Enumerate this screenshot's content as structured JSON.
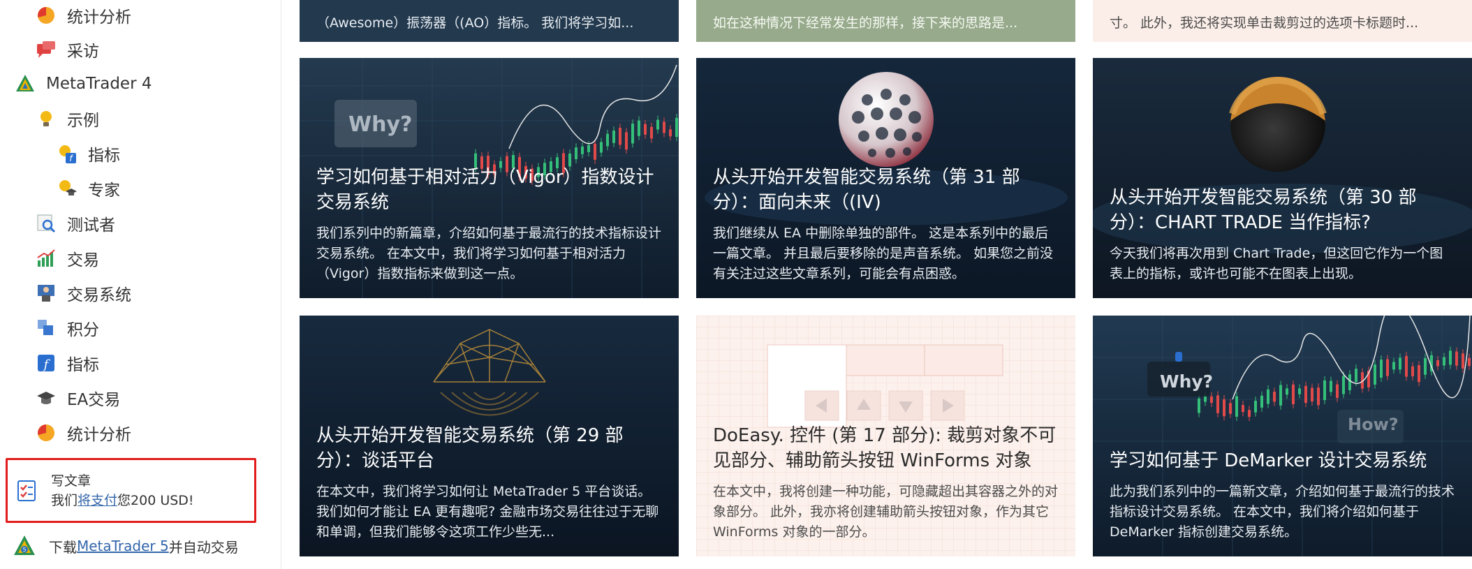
{
  "sidebar": {
    "items": [
      {
        "label": "统计分析",
        "icon": "pie-chart-icon"
      },
      {
        "label": "采访",
        "icon": "chat-icon"
      },
      {
        "label": "MetaTrader 4",
        "icon": "metatrader-logo-icon"
      },
      {
        "label": "示例",
        "icon": "lightbulb-icon"
      },
      {
        "label": "指标",
        "icon": "lightbulb-function-icon"
      },
      {
        "label": "专家",
        "icon": "lightbulb-graduate-icon"
      },
      {
        "label": "测试者",
        "icon": "magnifier-chart-icon"
      },
      {
        "label": "交易",
        "icon": "bar-chart-icon"
      },
      {
        "label": "交易系统",
        "icon": "trader-icon"
      },
      {
        "label": "积分",
        "icon": "integration-icon"
      },
      {
        "label": "指标",
        "icon": "function-icon"
      },
      {
        "label": "EA交易",
        "icon": "graduate-cap-icon"
      },
      {
        "label": "统计分析",
        "icon": "pie-chart-icon"
      }
    ],
    "promo": {
      "line1": "写文章",
      "line2_prefix": "我们",
      "line2_link": "将支付",
      "line2_suffix": "您200 USD!"
    },
    "download": {
      "prefix": "下载",
      "link": "MetaTrader 5",
      "suffix": "并自动交易"
    }
  },
  "top_row": [
    {
      "desc": "（Awesome）振荡器（(AO）指标。 我们将学习如..."
    },
    {
      "desc": "如在这种情况下经常发生的那样，接下来的思路是..."
    },
    {
      "desc": "寸。 此外，我还将实现单击裁剪过的选项卡标题时..."
    }
  ],
  "articles": [
    {
      "title": "学习如何基于相对活力（Vigor）指数设计交易系统",
      "desc": "我们系列中的新篇章，介绍如何基于最流行的技术指标设计交易系统。 在本文中，我们将学习如何基于相对活力（Vigor）指数指标来做到这一点。",
      "art_text": "Why?"
    },
    {
      "title": "从头开始开发智能交易系统（第 31 部分）：面向未来（(IV)",
      "desc": "我们继续从 EA 中删除单独的部件。 这是本系列中的最后一篇文章。 并且最后要移除的是声音系统。 如果您之前没有关注过这些文章系列，可能会有点困惑。"
    },
    {
      "title": "从头开始开发智能交易系统（第 30 部分）：CHART TRADE 当作指标?",
      "desc": "今天我们将再次用到 Chart Trade，但这回它作为一个图表上的指标，或许也可能不在图表上出现。"
    },
    {
      "title": "从头开始开发智能交易系统（第 29 部分）：谈话平台",
      "desc": "在本文中，我们将学习如何让 MetaTrader 5 平台谈话。 我们如何才能让 EA 更有趣呢? 金融市场交易往往过于无聊和单调，但我们能够令这项工作少些无..."
    },
    {
      "title": "DoEasy. 控件 (第 17 部分): 裁剪对象不可见部分、辅助箭头按钮 WinForms 对象",
      "desc": "在本文中，我将创建一种功能，可隐藏超出其容器之外的对象部分。 此外，我亦将创建辅助箭头按钮对象，作为其它 WinForms 对象的一部分。"
    },
    {
      "title": "学习如何基于 DeMarker 设计交易系统",
      "desc": "此为我们系列中的一篇新文章，介绍如何基于最流行的技术指标设计交易系统。 在本文中，我们将介绍如何基于 DeMarker 指标创建交易系统。",
      "art_text": "Why?",
      "art_text2": "How?"
    }
  ]
}
